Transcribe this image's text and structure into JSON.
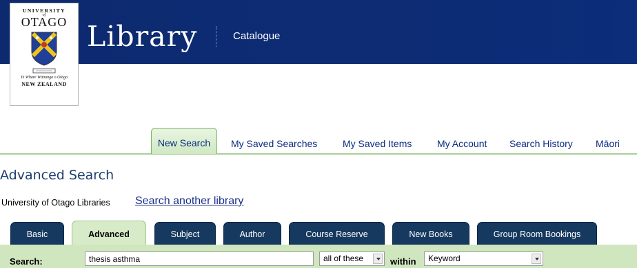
{
  "logo": {
    "university": "UNIVERSITY",
    "of": "of",
    "otago": "OTAGO",
    "maori_name": "Te Whare Wānanga o Otāgo",
    "country": "NEW ZEALAND"
  },
  "header": {
    "title": "Library",
    "subtitle": "Catalogue"
  },
  "nav": {
    "tabs": [
      {
        "label": "New Search"
      },
      {
        "label": "My Saved Searches"
      },
      {
        "label": "My Saved Items"
      },
      {
        "label": "My Account"
      },
      {
        "label": "Search History"
      },
      {
        "label": "Māori"
      }
    ]
  },
  "page": {
    "title": "Advanced Search",
    "library_name": "University of Otago Libraries",
    "search_another": "Search another library"
  },
  "search_tabs": [
    {
      "label": "Basic"
    },
    {
      "label": "Advanced"
    },
    {
      "label": "Subject"
    },
    {
      "label": "Author"
    },
    {
      "label": "Course Reserve"
    },
    {
      "label": "New Books"
    },
    {
      "label": "Group Room Bookings"
    }
  ],
  "search": {
    "label": "Search:",
    "query": "thesis asthma",
    "match_option": "all of these",
    "within_label": "within",
    "field_option": "Keyword"
  },
  "colors": {
    "banner": "#0d2a6f",
    "nav_green": "#cfe8c2",
    "tab_dark": "#16395f",
    "search_bar": "#cfe6bf"
  }
}
